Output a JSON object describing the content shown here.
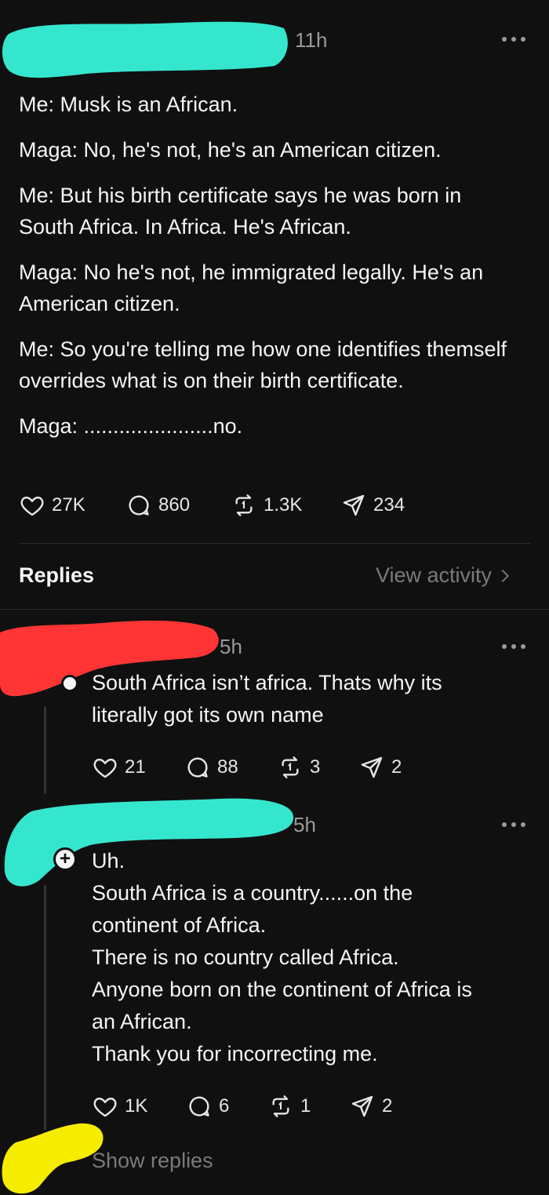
{
  "post": {
    "time": "11h",
    "lines": [
      "Me: Musk is an African.",
      "Maga: No, he's not, he's an American citizen.",
      "Me: But his birth certificate says he was born in South Africa. In Africa. He's African.",
      "Maga: No he's not, he immigrated legally. He's an American citizen.",
      "Me: So you're telling me how one identifies themself overrides what is on their birth certificate.",
      "Maga: ......................no."
    ],
    "stats": {
      "likes": "27K",
      "comments": "860",
      "reposts": "1.3K",
      "shares": "234"
    }
  },
  "replies_header": {
    "title": "Replies",
    "view_activity": "View activity"
  },
  "replies": [
    {
      "time": "5h",
      "text_lines": [
        "South Africa isn’t africa. Thats why its",
        "literally got its own name"
      ],
      "stats": {
        "likes": "21",
        "comments": "88",
        "reposts": "3",
        "shares": "2"
      }
    },
    {
      "time": "5h",
      "text_lines": [
        "Uh.",
        "South Africa is a country......on the",
        "continent of Africa.",
        "There is no country called Africa.",
        "Anyone born on the continent of Africa is",
        "an African.",
        "Thank you for incorrecting me."
      ],
      "stats": {
        "likes": "1K",
        "comments": "6",
        "reposts": "1",
        "shares": "2"
      },
      "show_replies": "Show replies"
    }
  ],
  "colors": {
    "background": "#101010",
    "redaction_teal": "#35e6cf",
    "redaction_red": "#ff3535",
    "redaction_yellow": "#f5ec00"
  },
  "icons": [
    "more-icon",
    "heart-icon",
    "comment-icon",
    "repost-icon",
    "share-icon",
    "chevron-right-icon",
    "plus-icon"
  ]
}
